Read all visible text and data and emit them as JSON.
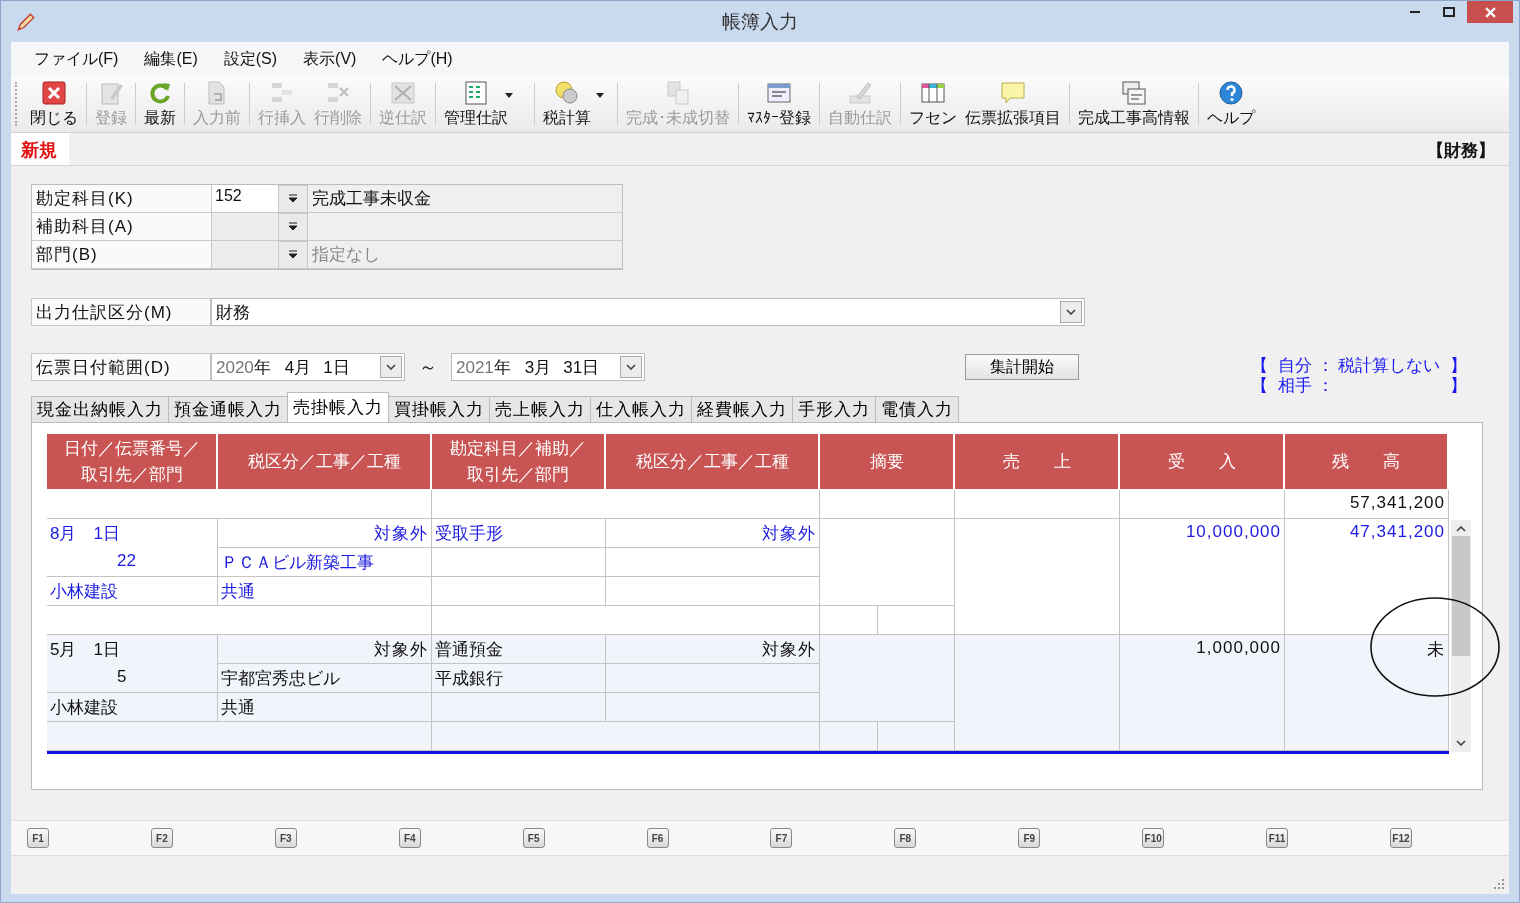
{
  "window": {
    "title": "帳簿入力"
  },
  "menu": [
    "ファイル(F)",
    "編集(E)",
    "設定(S)",
    "表示(V)",
    "ヘルプ(H)"
  ],
  "toolbar": [
    {
      "label": "閉じる",
      "enabled": true,
      "dropdown": false
    },
    {
      "label": "登録",
      "enabled": false,
      "dropdown": false
    },
    {
      "label": "最新",
      "enabled": true,
      "dropdown": false
    },
    {
      "label": "入力前",
      "enabled": false,
      "dropdown": false
    },
    {
      "label": "行挿入",
      "enabled": false,
      "dropdown": false
    },
    {
      "label": "行削除",
      "enabled": false,
      "dropdown": false
    },
    {
      "label": "逆仕訳",
      "enabled": false,
      "dropdown": false
    },
    {
      "label": "管理仕訳",
      "enabled": true,
      "dropdown": true
    },
    {
      "label": "税計算",
      "enabled": true,
      "dropdown": true
    },
    {
      "label": "完成･未成切替",
      "enabled": false,
      "dropdown": false
    },
    {
      "label": "ﾏｽﾀｰ登録",
      "enabled": true,
      "dropdown": false
    },
    {
      "label": "自動仕訳",
      "enabled": false,
      "dropdown": false
    },
    {
      "label": "フセン",
      "enabled": true,
      "dropdown": false
    },
    {
      "label": "伝票拡張項目",
      "enabled": true,
      "dropdown": false
    },
    {
      "label": "完成工事高情報",
      "enabled": true,
      "dropdown": false
    },
    {
      "label": "ヘルプ",
      "enabled": true,
      "dropdown": false
    }
  ],
  "mode": "新規",
  "ledger_kind": "【財務】",
  "account_fields": [
    {
      "label": "勘定科目(K)",
      "code": "152",
      "disabled": false,
      "name": "完成工事未収金"
    },
    {
      "label": "補助科目(A)",
      "disabled": true
    },
    {
      "label": "部門(B)",
      "disabled": true,
      "placeholder": "指定なし"
    }
  ],
  "output_class": {
    "label": "出力仕訳区分(M)",
    "value": "財務"
  },
  "date_range": {
    "label": "伝票日付範囲(D)",
    "separator": "～",
    "from": {
      "year": "2020",
      "unit": "年",
      "month": "4月",
      "day": "1日"
    },
    "to": {
      "year": "2021",
      "unit": "年",
      "month": "3月",
      "day": "31日"
    }
  },
  "aggregate_button": "集計開始",
  "tax_info": [
    {
      "open": "【",
      "text": "自分 ： 税計算しない",
      "close": "】"
    },
    {
      "open": "【",
      "text": "相手 ：",
      "close": "】"
    }
  ],
  "tabs": [
    {
      "label": "現金出納帳入力",
      "selected": false
    },
    {
      "label": "預金通帳入力",
      "selected": false
    },
    {
      "label": "売掛帳入力",
      "selected": true
    },
    {
      "label": "買掛帳入力",
      "selected": false
    },
    {
      "label": "売上帳入力",
      "selected": false
    },
    {
      "label": "仕入帳入力",
      "selected": false
    },
    {
      "label": "経費帳入力",
      "selected": false
    },
    {
      "label": "手形入力",
      "selected": false
    },
    {
      "label": "電債入力",
      "selected": false
    }
  ],
  "ledger": {
    "columns": [
      [
        "日付／伝票番号／",
        "取引先／部門"
      ],
      [
        "税区分／工事／工種"
      ],
      [
        "勘定科目／補助／",
        "取引先／部門"
      ],
      [
        "税区分／工事／工種"
      ],
      [
        "摘要"
      ],
      [
        "売　　上"
      ],
      [
        "受　　入"
      ],
      [
        "残　　高"
      ]
    ],
    "opening_balance": "57,341,200",
    "entries": [
      {
        "selected": true,
        "date": "8月　1日",
        "slip_no": "22",
        "partner": "小林建設",
        "tax_class": "対象外",
        "project": "ＰＣＡビル新築工事",
        "work_type": "共通",
        "account": "受取手形",
        "counter_tax_class": "対象外",
        "receipt": "10,000,000",
        "balance": "47,341,200"
      },
      {
        "selected": false,
        "date": "5月　1日",
        "slip_no": "5",
        "partner": "小林建設",
        "tax_class": "対象外",
        "project": "宇都宮秀忠ビル",
        "work_type": "共通",
        "account": "普通預金",
        "sub_account": "平成銀行",
        "counter_tax_class": "対象外",
        "receipt": "1,000,000",
        "balance": "未"
      }
    ]
  },
  "function_keys": [
    "F1",
    "F2",
    "F3",
    "F4",
    "F5",
    "F6",
    "F7",
    "F8",
    "F9",
    "F10",
    "F11",
    "F12"
  ]
}
